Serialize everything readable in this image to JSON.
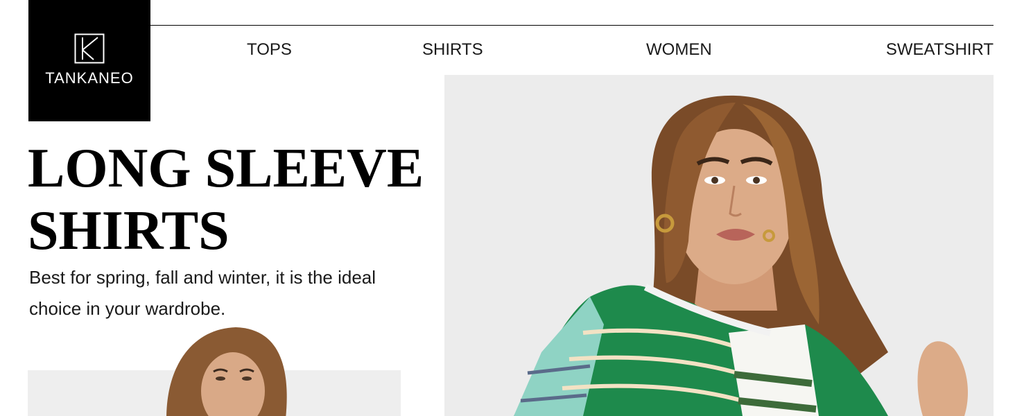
{
  "brand": {
    "name": "TANKANEO",
    "logo_icon": "k-monogram-icon"
  },
  "nav": {
    "items": [
      {
        "label": "TOPS"
      },
      {
        "label": "SHIRTS"
      },
      {
        "label": "WOMEN"
      },
      {
        "label": "SWEATSHIRT"
      }
    ]
  },
  "hero": {
    "headline_line1": "LONG SLEEVE",
    "headline_line2": "SHIRTS",
    "description": "Best for spring, fall and winter, it is the ideal choice in your wardrobe."
  },
  "images": {
    "main_photo": "model-striped-shirt-photo",
    "secondary_photo": "model-portrait-photo"
  },
  "colors": {
    "logo_background": "#000000",
    "logo_text": "#ffffff",
    "shirt_green": "#1e8a4c",
    "shirt_mint": "#8fd3c4",
    "photo_background": "#ececec"
  }
}
